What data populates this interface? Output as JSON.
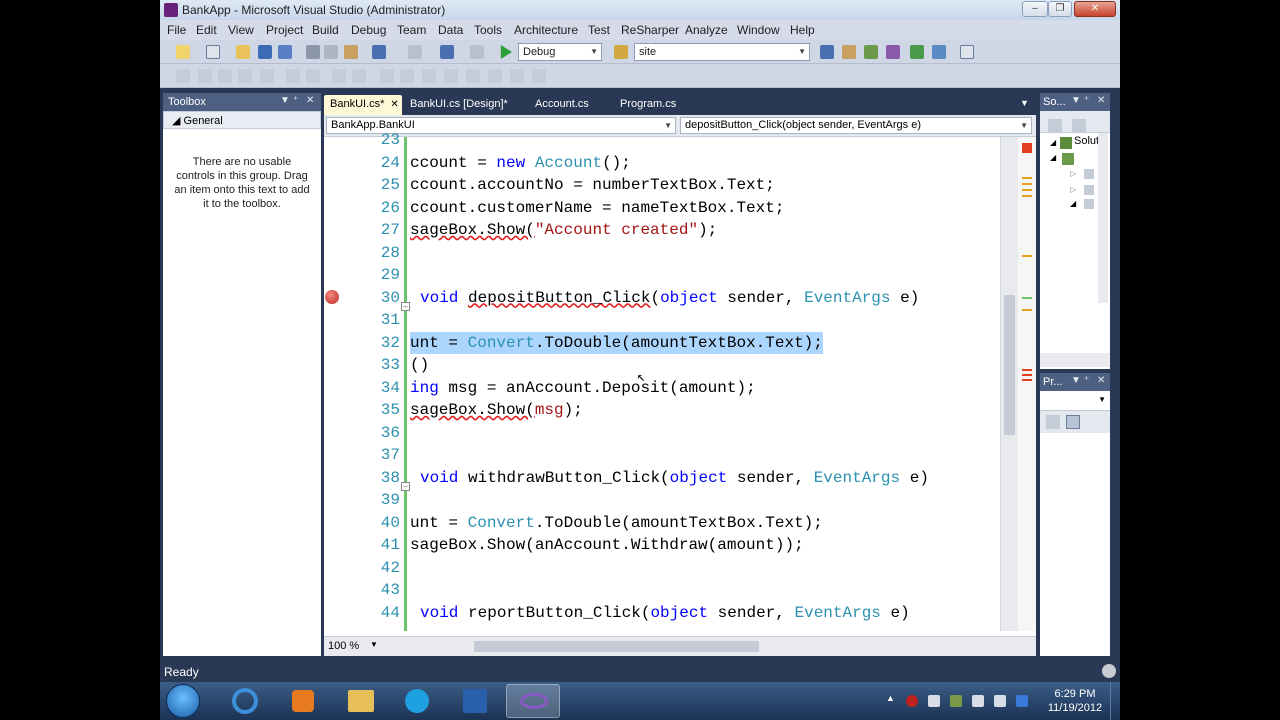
{
  "window": {
    "title": "BankApp - Microsoft Visual Studio (Administrator)",
    "controls": [
      "minimize",
      "maximize",
      "close"
    ]
  },
  "menu": [
    "File",
    "Edit",
    "View",
    "Project",
    "Build",
    "Debug",
    "Team",
    "Data",
    "Tools",
    "Architecture",
    "Test",
    "ReSharper",
    "Analyze",
    "Window",
    "Help"
  ],
  "toolbar": {
    "config_value": "Debug",
    "search_value": "site"
  },
  "toolbox": {
    "title": "Toolbox",
    "group": "General",
    "message": "There are no usable controls in this group. Drag an item onto this text to add it to the toolbox."
  },
  "tabs": [
    {
      "label": "BankUI.cs*",
      "active": true
    },
    {
      "label": "BankUI.cs [Design]*",
      "active": false
    },
    {
      "label": "Account.cs",
      "active": false
    },
    {
      "label": "Program.cs",
      "active": false
    }
  ],
  "navbar": {
    "class_value": "BankApp.BankUI",
    "member_value": "depositButton_Click(object sender, EventArgs e)"
  },
  "code": {
    "line_numbers": [
      "23",
      "24",
      "25",
      "26",
      "27",
      "28",
      "29",
      "30",
      "31",
      "32",
      "33",
      "34",
      "35",
      "36",
      "37",
      "38",
      "39",
      "40",
      "41",
      "42",
      "43",
      "44"
    ],
    "lines": {
      "l24": {
        "a": "ccount = ",
        "kw": "new",
        "sp": " ",
        "ty": "Account",
        "b": "();"
      },
      "l25": "ccount.accountNo = numberTextBox.Text;",
      "l26": "ccount.customerName = nameTextBox.Text;",
      "l27": {
        "a": "sageBox.Show(",
        "str": "\"Account created\"",
        "b": ");"
      },
      "l30": {
        "kw": "void",
        "m": "depositButton_Click",
        "p": "(",
        "kw2": "object",
        "s": " sender, ",
        "ty": "EventArgs",
        "e": " e)"
      },
      "l32": {
        "a": "unt = ",
        "ty": "Convert",
        "b": ".ToDouble(amountTextBox.Text);"
      },
      "l33": "()",
      "l34": {
        "kw": "ing",
        "a": " msg = anAccount.Deposit(amount);"
      },
      "l35": {
        "a": "sageBox.Show(",
        "str": "msg",
        "b": ");"
      },
      "l38": {
        "kw": "void",
        "m": "withdrawButton_Click",
        "p": "(",
        "kw2": "object",
        "s": " sender, ",
        "ty": "EventArgs",
        "e": " e)"
      },
      "l40": {
        "a": "unt = ",
        "ty": "Convert",
        "b": ".ToDouble(amountTextBox.Text);"
      },
      "l41": "sageBox.Show(anAccount.Withdraw(amount));",
      "l44": {
        "kw": "void",
        "m": "reportButton_Click",
        "p": "(",
        "kw2": "object",
        "s": " sender, ",
        "ty": "EventArgs",
        "e": " e)"
      }
    }
  },
  "editor_status": {
    "zoom": "100 %"
  },
  "solution_explorer": {
    "title": "So...",
    "item": "Soluti"
  },
  "properties": {
    "title": "Pr..."
  },
  "statusbar": {
    "text": "Ready"
  },
  "taskbar": {
    "time": "6:29 PM",
    "date": "11/19/2012"
  },
  "colors": {
    "keyword": "#0000ff",
    "type": "#2b91af",
    "string": "#a31515",
    "selection": "#add6ff",
    "breakpoint": "#c1271d",
    "chrome": "#293955"
  }
}
